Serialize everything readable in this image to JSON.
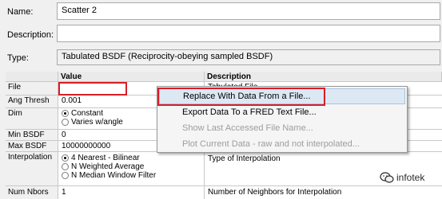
{
  "form": {
    "name_label": "Name:",
    "name_value": "Scatter 2",
    "description_label": "Description:",
    "description_value": "",
    "type_label": "Type:",
    "type_value": "Tabulated BSDF (Reciprocity-obeying sampled BSDF)"
  },
  "grid": {
    "columns": [
      "Value",
      "Description"
    ],
    "rows": [
      {
        "name": "File",
        "value": "",
        "description": "Tabulated File"
      },
      {
        "name": "Ang Thresh",
        "value": "0.001",
        "description": ""
      },
      {
        "name": "Dim",
        "options": [
          "Constant",
          "Varies w/angle"
        ],
        "selected": 0,
        "description": ""
      },
      {
        "name": "Min BSDF",
        "value": "0",
        "description": ""
      },
      {
        "name": "Max BSDF",
        "value": "10000000000",
        "description": ""
      },
      {
        "name": "Interpolation",
        "options": [
          "4 Nearest - Bilinear",
          "N Weighted Average",
          "N Median Window Filter"
        ],
        "selected": 0,
        "description": "Type of Interpolation"
      },
      {
        "name": "Num Nbors",
        "value": "1",
        "description": "Number of Neighbors for Interpolation"
      }
    ]
  },
  "context_menu": {
    "items": [
      {
        "label": "Replace With Data From a File...",
        "enabled": true,
        "highlighted": true
      },
      {
        "label": "Export Data To a FRED Text File...",
        "enabled": true,
        "highlighted": false
      },
      {
        "label": "Show Last Accessed File Name...",
        "enabled": false,
        "highlighted": false
      },
      {
        "label": "Plot Current Data - raw and not interpolated...",
        "enabled": false,
        "highlighted": false
      }
    ]
  },
  "watermark": {
    "text": "infotek",
    "icon": "wechat-icon"
  },
  "colors": {
    "annotation_red": "#d71e26",
    "menu_highlight": "#dde8f5"
  }
}
